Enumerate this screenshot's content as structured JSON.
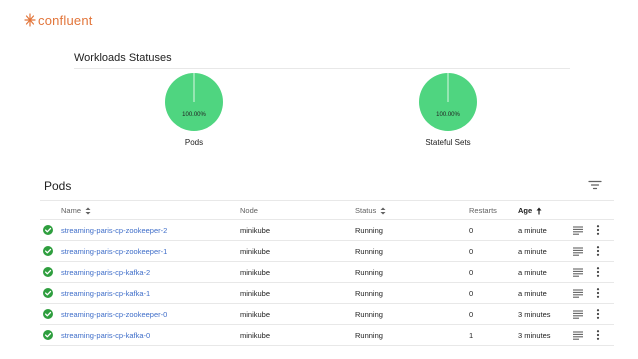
{
  "brand": {
    "name": "confluent",
    "accent": "#e2753a"
  },
  "workloads": {
    "title": "Workloads Statuses",
    "charts": [
      {
        "label": "Pods",
        "percent_label": "100.00%",
        "value": 100
      },
      {
        "label": "Stateful Sets",
        "percent_label": "100.00%",
        "value": 100
      }
    ],
    "color": "#4fd580"
  },
  "pods": {
    "title": "Pods",
    "columns": {
      "name": "Name",
      "node": "Node",
      "status": "Status",
      "restarts": "Restarts",
      "age": "Age"
    },
    "rows": [
      {
        "name": "streaming-paris-cp-zookeeper-2",
        "node": "minikube",
        "status": "Running",
        "restarts": "0",
        "age": "a minute"
      },
      {
        "name": "streaming-paris-cp-zookeeper-1",
        "node": "minikube",
        "status": "Running",
        "restarts": "0",
        "age": "a minute"
      },
      {
        "name": "streaming-paris-cp-kafka-2",
        "node": "minikube",
        "status": "Running",
        "restarts": "0",
        "age": "a minute"
      },
      {
        "name": "streaming-paris-cp-kafka-1",
        "node": "minikube",
        "status": "Running",
        "restarts": "0",
        "age": "a minute"
      },
      {
        "name": "streaming-paris-cp-zookeeper-0",
        "node": "minikube",
        "status": "Running",
        "restarts": "0",
        "age": "3 minutes"
      },
      {
        "name": "streaming-paris-cp-kafka-0",
        "node": "minikube",
        "status": "Running",
        "restarts": "1",
        "age": "3 minutes"
      }
    ],
    "status_color": "#2e9e3e",
    "link_color": "#3f6ec9"
  },
  "icons": {
    "logo": "confluent-logo-icon",
    "filter": "filter-icon",
    "sort": "sort-icon",
    "sort_active": "sort-ascending-icon",
    "status_ok": "check-circle-icon",
    "logs": "logs-icon",
    "more": "more-vert-icon"
  }
}
